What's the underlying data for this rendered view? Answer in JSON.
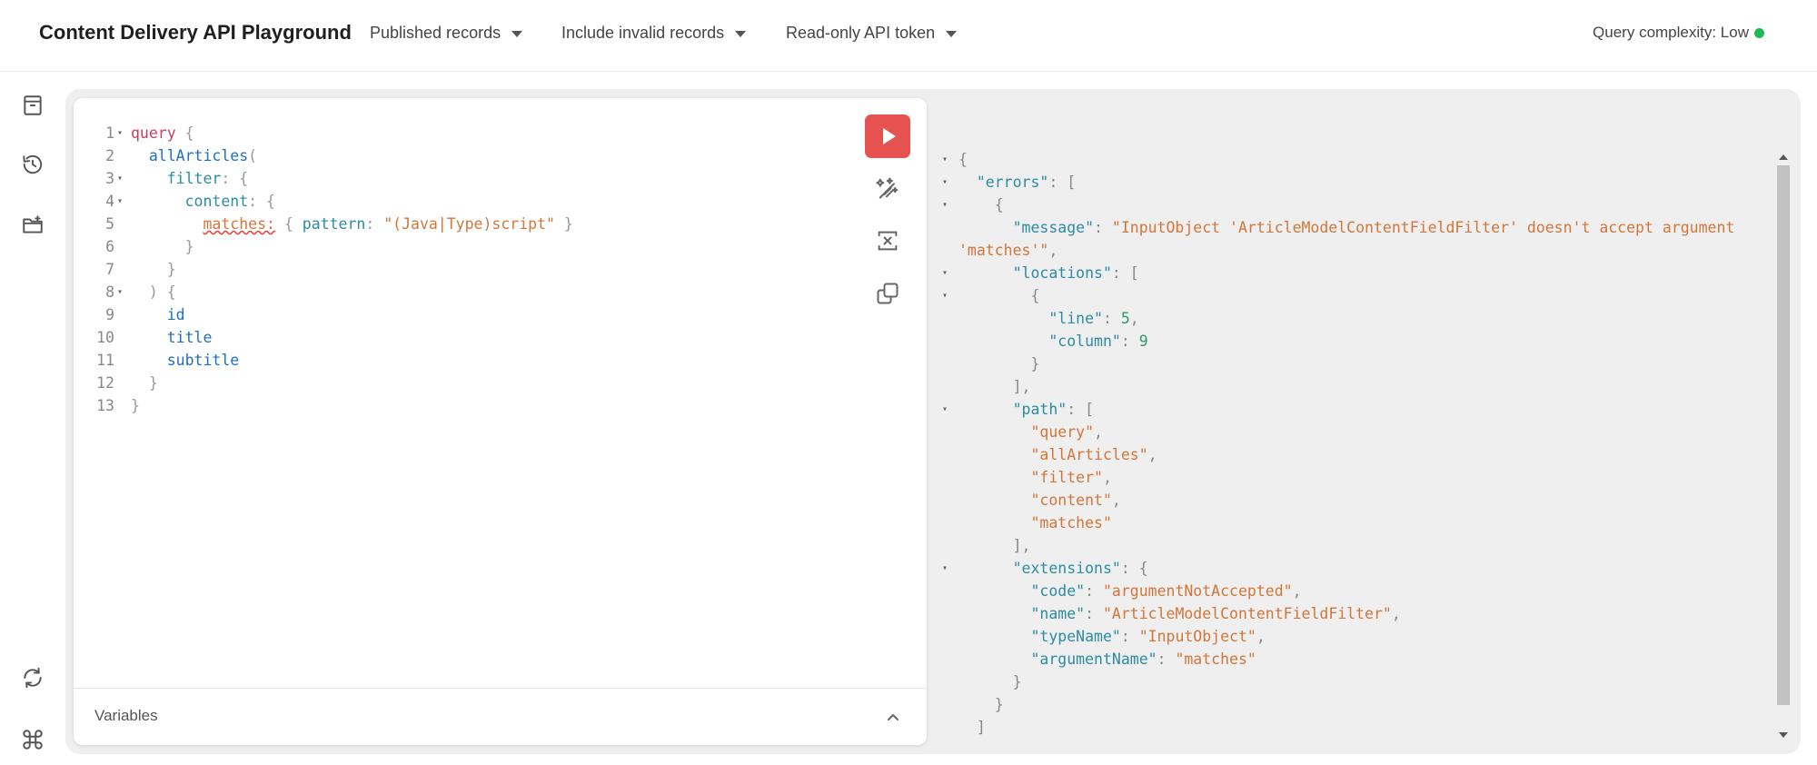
{
  "header": {
    "title": "Content Delivery API Playground",
    "dropdowns": [
      {
        "label": "Published records"
      },
      {
        "label": "Include invalid records"
      },
      {
        "label": "Read-only API token"
      }
    ],
    "complexity_label": "Query complexity: Low",
    "complexity_color": "#1db954"
  },
  "sidebar": {
    "icons": [
      "archive-icon",
      "history-icon",
      "folder-add-icon",
      "refresh-icon",
      "command-icon"
    ]
  },
  "editor": {
    "run_button_color": "#e5524f",
    "variables_label": "Variables",
    "lines": [
      {
        "n": "1",
        "fold": true,
        "parts": [
          {
            "t": "query",
            "c": "kw"
          },
          {
            "t": " {",
            "c": "p"
          }
        ]
      },
      {
        "n": "2",
        "fold": false,
        "parts": [
          {
            "t": "  ",
            "c": "p"
          },
          {
            "t": "allArticles",
            "c": "fn"
          },
          {
            "t": "(",
            "c": "p"
          }
        ]
      },
      {
        "n": "3",
        "fold": true,
        "parts": [
          {
            "t": "    ",
            "c": "p"
          },
          {
            "t": "filter",
            "c": "arg"
          },
          {
            "t": ": {",
            "c": "p"
          }
        ]
      },
      {
        "n": "4",
        "fold": true,
        "parts": [
          {
            "t": "      ",
            "c": "p"
          },
          {
            "t": "content",
            "c": "arg"
          },
          {
            "t": ": {",
            "c": "p"
          }
        ]
      },
      {
        "n": "5",
        "fold": false,
        "parts": [
          {
            "t": "        ",
            "c": "p"
          },
          {
            "t": "matches:",
            "c": "err"
          },
          {
            "t": " { ",
            "c": "p"
          },
          {
            "t": "pattern",
            "c": "arg"
          },
          {
            "t": ": ",
            "c": "p"
          },
          {
            "t": "\"(Java|Type)script\"",
            "c": "str"
          },
          {
            "t": " }",
            "c": "p"
          }
        ]
      },
      {
        "n": "6",
        "fold": false,
        "parts": [
          {
            "t": "      }",
            "c": "p"
          }
        ]
      },
      {
        "n": "7",
        "fold": false,
        "parts": [
          {
            "t": "    }",
            "c": "p"
          }
        ]
      },
      {
        "n": "8",
        "fold": true,
        "parts": [
          {
            "t": "  ) {",
            "c": "p"
          }
        ]
      },
      {
        "n": "9",
        "fold": false,
        "parts": [
          {
            "t": "    ",
            "c": "p"
          },
          {
            "t": "id",
            "c": "fn"
          }
        ]
      },
      {
        "n": "10",
        "fold": false,
        "parts": [
          {
            "t": "    ",
            "c": "p"
          },
          {
            "t": "title",
            "c": "fn"
          }
        ]
      },
      {
        "n": "11",
        "fold": false,
        "parts": [
          {
            "t": "    ",
            "c": "p"
          },
          {
            "t": "subtitle",
            "c": "fn"
          }
        ]
      },
      {
        "n": "12",
        "fold": false,
        "parts": [
          {
            "t": "  }",
            "c": "p"
          }
        ]
      },
      {
        "n": "13",
        "fold": false,
        "parts": [
          {
            "t": "}",
            "c": "p"
          }
        ]
      }
    ]
  },
  "result": {
    "lines": [
      {
        "fold": true,
        "parts": [
          {
            "t": "{",
            "c": "p"
          }
        ]
      },
      {
        "fold": true,
        "parts": [
          {
            "t": "  ",
            "c": "p"
          },
          {
            "t": "\"errors\"",
            "c": "key"
          },
          {
            "t": ": [",
            "c": "p"
          }
        ]
      },
      {
        "fold": true,
        "parts": [
          {
            "t": "    {",
            "c": "p"
          }
        ]
      },
      {
        "fold": false,
        "parts": [
          {
            "t": "      ",
            "c": "p"
          },
          {
            "t": "\"message\"",
            "c": "key"
          },
          {
            "t": ": ",
            "c": "p"
          },
          {
            "t": "\"InputObject 'ArticleModelContentFieldFilter' doesn't accept argument",
            "c": "str"
          }
        ]
      },
      {
        "fold": false,
        "parts": [
          {
            "t": "'matches'\"",
            "c": "str"
          },
          {
            "t": ",",
            "c": "p"
          }
        ]
      },
      {
        "fold": true,
        "parts": [
          {
            "t": "      ",
            "c": "p"
          },
          {
            "t": "\"locations\"",
            "c": "key"
          },
          {
            "t": ": [",
            "c": "p"
          }
        ]
      },
      {
        "fold": true,
        "parts": [
          {
            "t": "        {",
            "c": "p"
          }
        ]
      },
      {
        "fold": false,
        "parts": [
          {
            "t": "          ",
            "c": "p"
          },
          {
            "t": "\"line\"",
            "c": "key"
          },
          {
            "t": ": ",
            "c": "p"
          },
          {
            "t": "5",
            "c": "num"
          },
          {
            "t": ",",
            "c": "p"
          }
        ]
      },
      {
        "fold": false,
        "parts": [
          {
            "t": "          ",
            "c": "p"
          },
          {
            "t": "\"column\"",
            "c": "key"
          },
          {
            "t": ": ",
            "c": "p"
          },
          {
            "t": "9",
            "c": "num"
          }
        ]
      },
      {
        "fold": false,
        "parts": [
          {
            "t": "        }",
            "c": "p"
          }
        ]
      },
      {
        "fold": false,
        "parts": [
          {
            "t": "      ],",
            "c": "p"
          }
        ]
      },
      {
        "fold": true,
        "parts": [
          {
            "t": "      ",
            "c": "p"
          },
          {
            "t": "\"path\"",
            "c": "key"
          },
          {
            "t": ": [",
            "c": "p"
          }
        ]
      },
      {
        "fold": false,
        "parts": [
          {
            "t": "        ",
            "c": "p"
          },
          {
            "t": "\"query\"",
            "c": "str"
          },
          {
            "t": ",",
            "c": "p"
          }
        ]
      },
      {
        "fold": false,
        "parts": [
          {
            "t": "        ",
            "c": "p"
          },
          {
            "t": "\"allArticles\"",
            "c": "str"
          },
          {
            "t": ",",
            "c": "p"
          }
        ]
      },
      {
        "fold": false,
        "parts": [
          {
            "t": "        ",
            "c": "p"
          },
          {
            "t": "\"filter\"",
            "c": "str"
          },
          {
            "t": ",",
            "c": "p"
          }
        ]
      },
      {
        "fold": false,
        "parts": [
          {
            "t": "        ",
            "c": "p"
          },
          {
            "t": "\"content\"",
            "c": "str"
          },
          {
            "t": ",",
            "c": "p"
          }
        ]
      },
      {
        "fold": false,
        "parts": [
          {
            "t": "        ",
            "c": "p"
          },
          {
            "t": "\"matches\"",
            "c": "str"
          }
        ]
      },
      {
        "fold": false,
        "parts": [
          {
            "t": "      ],",
            "c": "p"
          }
        ]
      },
      {
        "fold": true,
        "parts": [
          {
            "t": "      ",
            "c": "p"
          },
          {
            "t": "\"extensions\"",
            "c": "key"
          },
          {
            "t": ": {",
            "c": "p"
          }
        ]
      },
      {
        "fold": false,
        "parts": [
          {
            "t": "        ",
            "c": "p"
          },
          {
            "t": "\"code\"",
            "c": "key"
          },
          {
            "t": ": ",
            "c": "p"
          },
          {
            "t": "\"argumentNotAccepted\"",
            "c": "str"
          },
          {
            "t": ",",
            "c": "p"
          }
        ]
      },
      {
        "fold": false,
        "parts": [
          {
            "t": "        ",
            "c": "p"
          },
          {
            "t": "\"name\"",
            "c": "key"
          },
          {
            "t": ": ",
            "c": "p"
          },
          {
            "t": "\"ArticleModelContentFieldFilter\"",
            "c": "str"
          },
          {
            "t": ",",
            "c": "p"
          }
        ]
      },
      {
        "fold": false,
        "parts": [
          {
            "t": "        ",
            "c": "p"
          },
          {
            "t": "\"typeName\"",
            "c": "key"
          },
          {
            "t": ": ",
            "c": "p"
          },
          {
            "t": "\"InputObject\"",
            "c": "str"
          },
          {
            "t": ",",
            "c": "p"
          }
        ]
      },
      {
        "fold": false,
        "parts": [
          {
            "t": "        ",
            "c": "p"
          },
          {
            "t": "\"argumentName\"",
            "c": "key"
          },
          {
            "t": ": ",
            "c": "p"
          },
          {
            "t": "\"matches\"",
            "c": "str"
          }
        ]
      },
      {
        "fold": false,
        "parts": [
          {
            "t": "      }",
            "c": "p"
          }
        ]
      },
      {
        "fold": false,
        "parts": [
          {
            "t": "    }",
            "c": "p"
          }
        ]
      },
      {
        "fold": false,
        "parts": [
          {
            "t": "  ]",
            "c": "p"
          }
        ]
      }
    ]
  }
}
